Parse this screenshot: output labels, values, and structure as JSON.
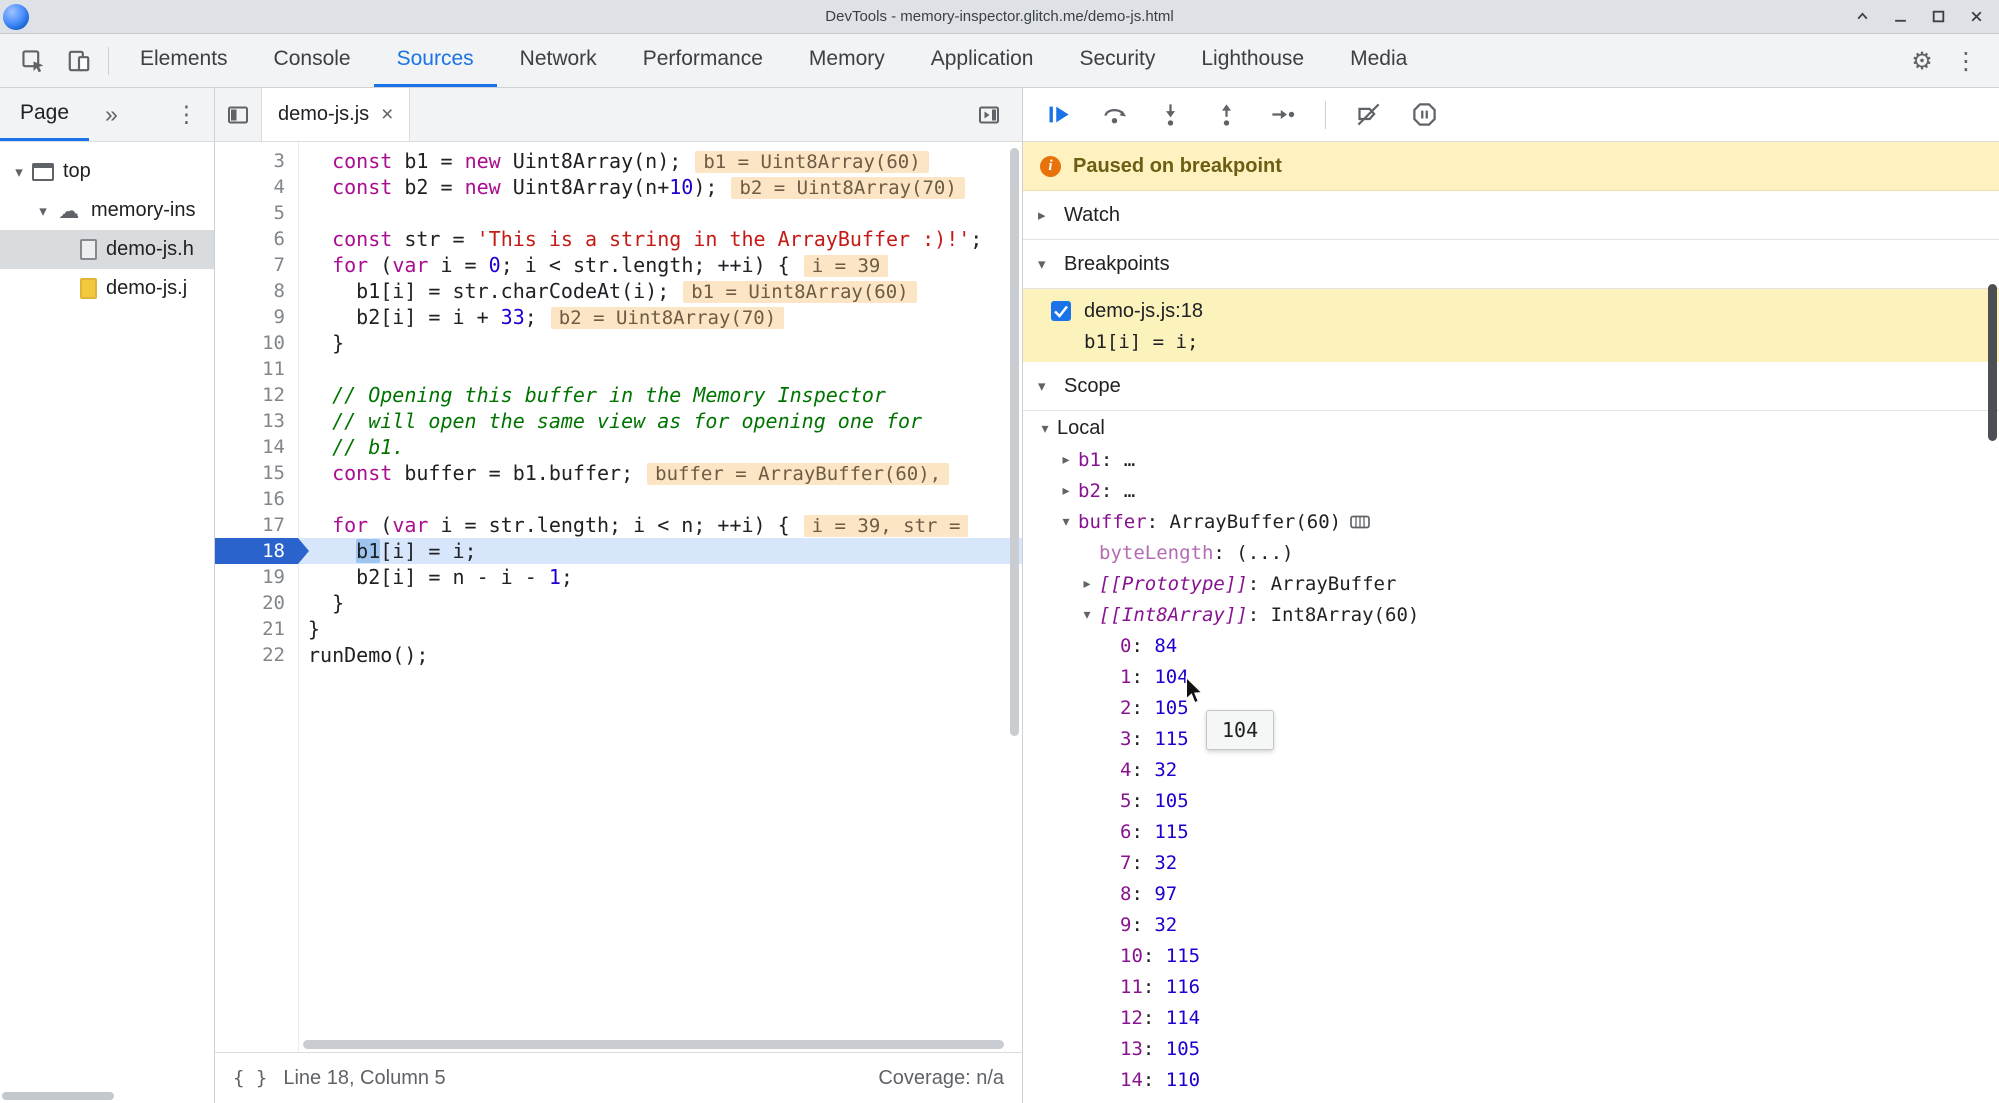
{
  "titlebar": {
    "title": "DevTools - memory-inspector.glitch.me/demo-js.html"
  },
  "glyphs": {
    "more_tabs": "»",
    "kebab_menu": "⋮",
    "gear": "⚙",
    "tab_close": "×",
    "tri_down": "▾",
    "tri_right": "▸",
    "cloud": "☁",
    "braces": "{ }",
    "info_i": "i",
    "ellipsis": "…"
  },
  "toolbar": {
    "tabs": [
      "Elements",
      "Console",
      "Sources",
      "Network",
      "Performance",
      "Memory",
      "Application",
      "Security",
      "Lighthouse",
      "Media"
    ],
    "active_tab_index": 2
  },
  "navigator": {
    "header": {
      "tab": "Page"
    },
    "tree": [
      {
        "label": "top",
        "level": 0,
        "expanded": true,
        "icon": "frame",
        "selected": false
      },
      {
        "label": "memory-ins",
        "level": 1,
        "expanded": true,
        "icon": "cloud",
        "selected": false
      },
      {
        "label": "demo-js.h",
        "level": 2,
        "icon": "file-html",
        "selected": true
      },
      {
        "label": "demo-js.j",
        "level": 2,
        "icon": "file-js",
        "selected": false
      }
    ]
  },
  "editor": {
    "tab_label": "demo-js.js",
    "status": {
      "position": "Line 18, Column 5",
      "coverage": "Coverage: n/a"
    },
    "lines": [
      {
        "n": 3,
        "segs": [
          [
            "  ",
            "p"
          ],
          [
            "const",
            "k"
          ],
          [
            " b1 = ",
            "p"
          ],
          [
            "new",
            "k"
          ],
          [
            " Uint8Array(n);",
            "p"
          ]
        ],
        "inline": "b1 = Uint8Array(60)"
      },
      {
        "n": 4,
        "segs": [
          [
            "  ",
            "p"
          ],
          [
            "const",
            "k"
          ],
          [
            " b2 = ",
            "p"
          ],
          [
            "new",
            "k"
          ],
          [
            " Uint8Array(n+",
            "p"
          ],
          [
            "10",
            "n"
          ],
          [
            ");",
            "p"
          ]
        ],
        "inline": "b2 = Uint8Array(70)"
      },
      {
        "n": 5,
        "segs": []
      },
      {
        "n": 6,
        "segs": [
          [
            "  ",
            "p"
          ],
          [
            "const",
            "k"
          ],
          [
            " str = ",
            "p"
          ],
          [
            "'This is a string in the ArrayBuffer :)!'",
            "s"
          ],
          [
            ";",
            "p"
          ]
        ]
      },
      {
        "n": 7,
        "segs": [
          [
            "  ",
            "p"
          ],
          [
            "for",
            "k"
          ],
          [
            " (",
            "p"
          ],
          [
            "var",
            "k"
          ],
          [
            " i = ",
            "p"
          ],
          [
            "0",
            "n"
          ],
          [
            "; i < str.length; ++i) {",
            "p"
          ]
        ],
        "inline": "i = 39"
      },
      {
        "n": 8,
        "segs": [
          [
            "    b1[i] = str.charCodeAt(i);",
            "p"
          ]
        ],
        "inline": "b1 = Uint8Array(60)"
      },
      {
        "n": 9,
        "segs": [
          [
            "    b2[i] = i + ",
            "p"
          ],
          [
            "33",
            "n"
          ],
          [
            ";",
            "p"
          ]
        ],
        "inline": "b2 = Uint8Array(70)"
      },
      {
        "n": 10,
        "segs": [
          [
            "  }",
            "p"
          ]
        ]
      },
      {
        "n": 11,
        "segs": []
      },
      {
        "n": 12,
        "segs": [
          [
            "  // Opening this buffer in the Memory Inspector",
            "c"
          ]
        ]
      },
      {
        "n": 13,
        "segs": [
          [
            "  // will open the same view as for opening one for",
            "c"
          ]
        ]
      },
      {
        "n": 14,
        "segs": [
          [
            "  // b1.",
            "c"
          ]
        ]
      },
      {
        "n": 15,
        "segs": [
          [
            "  ",
            "p"
          ],
          [
            "const",
            "k"
          ],
          [
            " buffer = b1.buffer;",
            "p"
          ]
        ],
        "inline": "buffer = ArrayBuffer(60),"
      },
      {
        "n": 16,
        "segs": []
      },
      {
        "n": 17,
        "segs": [
          [
            "  ",
            "p"
          ],
          [
            "for",
            "k"
          ],
          [
            " (",
            "p"
          ],
          [
            "var",
            "k"
          ],
          [
            " i = str.length; i < n; ++i) {",
            "p"
          ]
        ],
        "inline": "i = 39, str ="
      },
      {
        "n": 18,
        "current": true,
        "segs": [
          [
            "    ",
            "p"
          ],
          [
            "b1",
            "h"
          ],
          [
            "[i] = i;",
            "p"
          ]
        ]
      },
      {
        "n": 19,
        "segs": [
          [
            "    b2[i] = n - i - ",
            "p"
          ],
          [
            "1",
            "n"
          ],
          [
            ";",
            "p"
          ]
        ]
      },
      {
        "n": 20,
        "segs": [
          [
            "  }",
            "p"
          ]
        ]
      },
      {
        "n": 21,
        "segs": [
          [
            "}",
            "p"
          ]
        ]
      },
      {
        "n": 22,
        "segs": [
          [
            "runDemo();",
            "p"
          ]
        ]
      }
    ]
  },
  "debugger": {
    "paused_message": "Paused on breakpoint",
    "sections": {
      "watch": "Watch",
      "breakpoints": "Breakpoints",
      "scope": "Scope"
    },
    "breakpoint": {
      "location": "demo-js.js:18",
      "code": "b1[i] = i;",
      "checked": true
    },
    "tooltip": "104",
    "scope": {
      "rows": [
        {
          "indent": 0,
          "arrow": "down",
          "name": "Local",
          "style": "title"
        },
        {
          "indent": 1,
          "arrow": "right",
          "name": "b1",
          "style": "prop",
          "value": "…"
        },
        {
          "indent": 1,
          "arrow": "right",
          "name": "b2",
          "style": "prop",
          "value": "…"
        },
        {
          "indent": 1,
          "arrow": "down",
          "name": "buffer",
          "style": "prop",
          "value": "ArrayBuffer(60)",
          "icon": "memory"
        },
        {
          "indent": 2,
          "arrow": "none",
          "name": "byteLength",
          "style": "accessor",
          "value": "(...)"
        },
        {
          "indent": 2,
          "arrow": "right",
          "name": "[[Prototype]]",
          "style": "internal",
          "value": "ArrayBuffer"
        },
        {
          "indent": 2,
          "arrow": "down",
          "name": "[[Int8Array]]",
          "style": "internal",
          "value": "Int8Array(60)"
        },
        {
          "indent": 3,
          "arrow": "none",
          "name": "0",
          "style": "prop",
          "value": "84",
          "vstyle": "num"
        },
        {
          "indent": 3,
          "arrow": "none",
          "name": "1",
          "style": "prop",
          "value": "104",
          "vstyle": "num"
        },
        {
          "indent": 3,
          "arrow": "none",
          "name": "2",
          "style": "prop",
          "value": "105",
          "vstyle": "num"
        },
        {
          "indent": 3,
          "arrow": "none",
          "name": "3",
          "style": "prop",
          "value": "115",
          "vstyle": "num"
        },
        {
          "indent": 3,
          "arrow": "none",
          "name": "4",
          "style": "prop",
          "value": "32",
          "vstyle": "num"
        },
        {
          "indent": 3,
          "arrow": "none",
          "name": "5",
          "style": "prop",
          "value": "105",
          "vstyle": "num"
        },
        {
          "indent": 3,
          "arrow": "none",
          "name": "6",
          "style": "prop",
          "value": "115",
          "vstyle": "num"
        },
        {
          "indent": 3,
          "arrow": "none",
          "name": "7",
          "style": "prop",
          "value": "32",
          "vstyle": "num"
        },
        {
          "indent": 3,
          "arrow": "none",
          "name": "8",
          "style": "prop",
          "value": "97",
          "vstyle": "num"
        },
        {
          "indent": 3,
          "arrow": "none",
          "name": "9",
          "style": "prop",
          "value": "32",
          "vstyle": "num"
        },
        {
          "indent": 3,
          "arrow": "none",
          "name": "10",
          "style": "prop",
          "value": "115",
          "vstyle": "num"
        },
        {
          "indent": 3,
          "arrow": "none",
          "name": "11",
          "style": "prop",
          "value": "116",
          "vstyle": "num"
        },
        {
          "indent": 3,
          "arrow": "none",
          "name": "12",
          "style": "prop",
          "value": "114",
          "vstyle": "num"
        },
        {
          "indent": 3,
          "arrow": "none",
          "name": "13",
          "style": "prop",
          "value": "105",
          "vstyle": "num"
        },
        {
          "indent": 3,
          "arrow": "none",
          "name": "14",
          "style": "prop",
          "value": "110",
          "vstyle": "num"
        }
      ]
    }
  },
  "colors": {
    "accent_blue": "#1a73e8",
    "paused_banner_bg": "#fff2c0",
    "breakpoint_row_bg": "#fbf2bc",
    "execution_line_bg": "#d7e6fb",
    "execution_gutter_blue": "#2a63cc",
    "paused_token_bg": "#9ec4f0",
    "inline_eval_bg": "#fbe5c4",
    "property_purple": "#881391",
    "number_blue": "#1c00cf",
    "keyword_magenta": "#aa0d91",
    "string_red": "#c41a16",
    "comment_green": "#007400"
  }
}
